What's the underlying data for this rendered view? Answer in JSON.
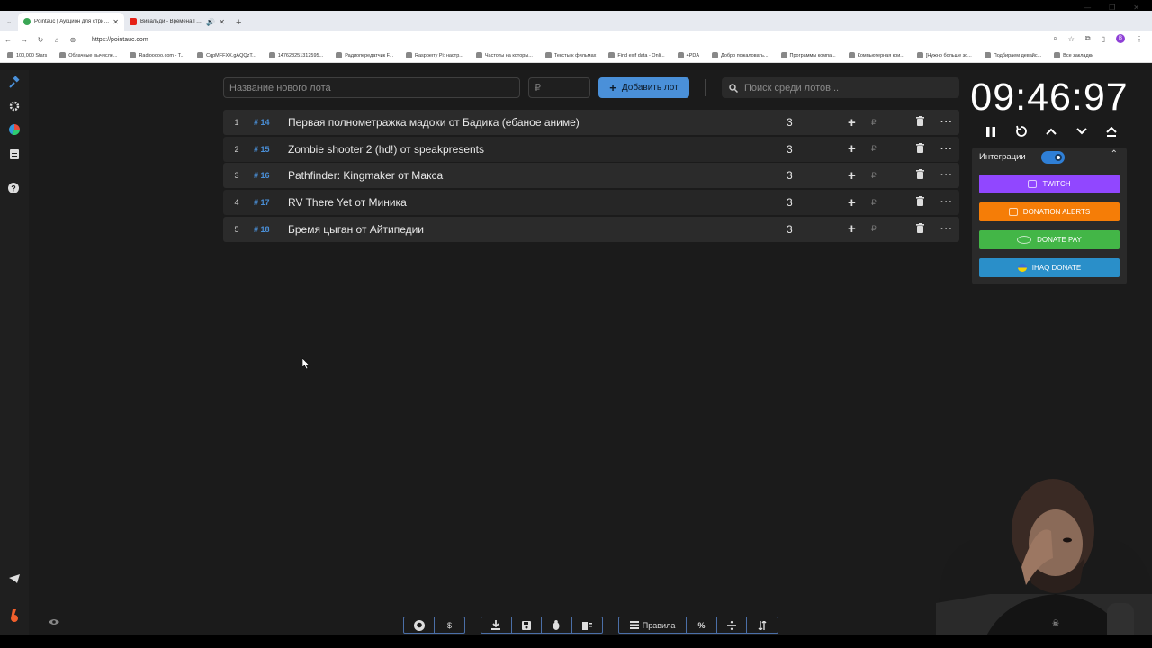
{
  "browser": {
    "tabs": [
      {
        "title": "Pointauc | Аукцион для стрима",
        "active": true,
        "color": "#3aa655"
      },
      {
        "title": "Вивальди - Времена Года",
        "active": false,
        "color": "#e62117"
      }
    ],
    "url": "https://pointauc.com",
    "bookmarks": [
      "100,000 Stars",
      "Облачные вычисле...",
      "Radiooooo.com - T...",
      "CqpMFFXX.gAQQzT...",
      "147628251312595...",
      "Радиопередатчик F...",
      "Raspberry Pi: настр...",
      "Частоты на которы...",
      "Тексты к фильмах",
      "Find exif data - Onli...",
      "4PDA",
      "Добро пожаловать...",
      "Программы компа...",
      "Компьютерная кри...",
      "[Нужно больше зо...",
      "Подбираем девайс...",
      "Все закладки"
    ],
    "profile_initial": "B"
  },
  "toolbar": {
    "new_lot_placeholder": "Название нового лота",
    "amount_placeholder": "₽",
    "add_lot_label": "Добавить лот",
    "search_placeholder": "Поиск среди лотов..."
  },
  "lots": [
    {
      "num": "1",
      "id": "# 14",
      "title": "Первая полнометражка мадоки от Бадика (ебаное аниме)",
      "amount": "3"
    },
    {
      "num": "2",
      "id": "# 15",
      "title": "Zombie shooter 2 (hd!) от speakpresents",
      "amount": "3"
    },
    {
      "num": "3",
      "id": "# 16",
      "title": "Pathfinder: Kingmaker от Макса",
      "amount": "3"
    },
    {
      "num": "4",
      "id": "# 17",
      "title": "RV There Yet от Миника",
      "amount": "3"
    },
    {
      "num": "5",
      "id": "# 18",
      "title": "Бремя цыган от Айтипедии",
      "amount": "3"
    }
  ],
  "lot_actions": {
    "plus": "+",
    "currency": "₽",
    "more": "···"
  },
  "timer": {
    "display": "09:46:97"
  },
  "integrations": {
    "title": "Интеграции",
    "enabled": true,
    "buttons": [
      {
        "label": "TWITCH",
        "color": "#9147ff"
      },
      {
        "label": "DONATION ALERTS",
        "color": "#f57d07"
      },
      {
        "label": "DONATE PAY",
        "color": "#43b647"
      },
      {
        "label": "IHAQ DONATE",
        "color": "#2a8fc9"
      }
    ]
  },
  "bottom_bar": {
    "rules_label": "Правила",
    "dollar": "$",
    "percent": "%"
  },
  "colors": {
    "accent": "#4a90d9",
    "background": "#1b1b1b",
    "row": "#2b2b2b"
  }
}
